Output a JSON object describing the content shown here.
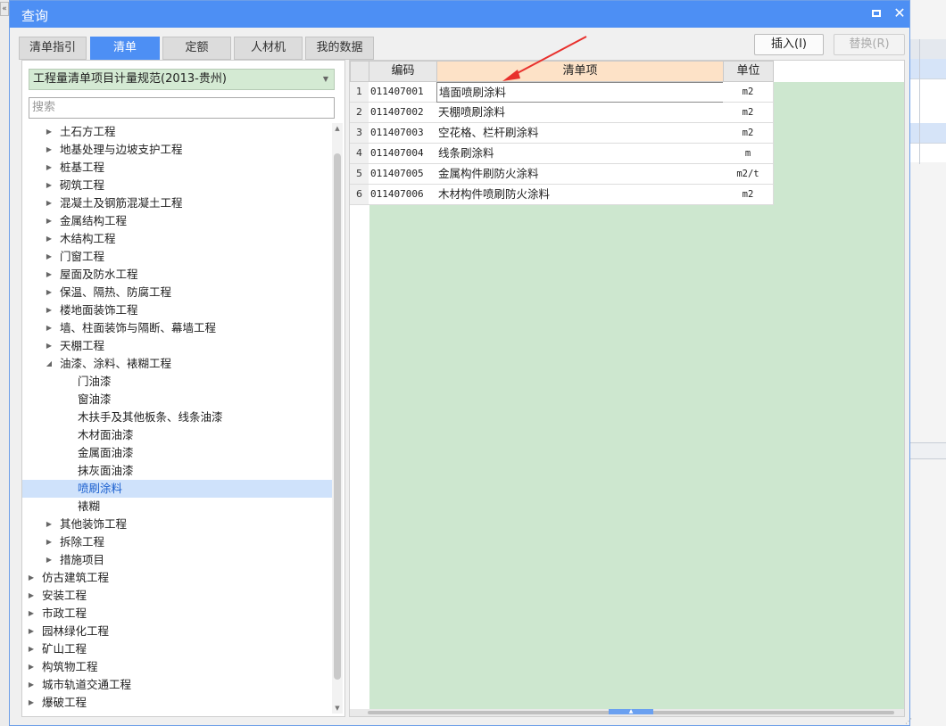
{
  "window": {
    "title": "查询"
  },
  "tabs": [
    {
      "label": "清单指引",
      "active": false
    },
    {
      "label": "清单",
      "active": true
    },
    {
      "label": "定额",
      "active": false
    },
    {
      "label": "人材机",
      "active": false
    },
    {
      "label": "我的数据",
      "active": false
    }
  ],
  "actions": {
    "insert": "插入(I)",
    "replace": "替换(R)"
  },
  "spec": {
    "selected": "工程量清单项目计量规范(2013-贵州)"
  },
  "search": {
    "placeholder": "搜索"
  },
  "tree": [
    {
      "label": "土石方工程",
      "level": 1,
      "expandable": true,
      "expanded": false
    },
    {
      "label": "地基处理与边坡支护工程",
      "level": 1,
      "expandable": true,
      "expanded": false
    },
    {
      "label": "桩基工程",
      "level": 1,
      "expandable": true,
      "expanded": false
    },
    {
      "label": "砌筑工程",
      "level": 1,
      "expandable": true,
      "expanded": false
    },
    {
      "label": "混凝土及钢筋混凝土工程",
      "level": 1,
      "expandable": true,
      "expanded": false
    },
    {
      "label": "金属结构工程",
      "level": 1,
      "expandable": true,
      "expanded": false
    },
    {
      "label": "木结构工程",
      "level": 1,
      "expandable": true,
      "expanded": false
    },
    {
      "label": "门窗工程",
      "level": 1,
      "expandable": true,
      "expanded": false
    },
    {
      "label": "屋面及防水工程",
      "level": 1,
      "expandable": true,
      "expanded": false
    },
    {
      "label": "保温、隔热、防腐工程",
      "level": 1,
      "expandable": true,
      "expanded": false
    },
    {
      "label": "楼地面装饰工程",
      "level": 1,
      "expandable": true,
      "expanded": false
    },
    {
      "label": "墙、柱面装饰与隔断、幕墙工程",
      "level": 1,
      "expandable": true,
      "expanded": false
    },
    {
      "label": "天棚工程",
      "level": 1,
      "expandable": true,
      "expanded": false
    },
    {
      "label": "油漆、涂料、裱糊工程",
      "level": 1,
      "expandable": true,
      "expanded": true
    },
    {
      "label": "门油漆",
      "level": 2,
      "expandable": false
    },
    {
      "label": "窗油漆",
      "level": 2,
      "expandable": false
    },
    {
      "label": "木扶手及其他板条、线条油漆",
      "level": 2,
      "expandable": false
    },
    {
      "label": "木材面油漆",
      "level": 2,
      "expandable": false
    },
    {
      "label": "金属面油漆",
      "level": 2,
      "expandable": false
    },
    {
      "label": "抹灰面油漆",
      "level": 2,
      "expandable": false
    },
    {
      "label": "喷刷涂料",
      "level": 2,
      "expandable": false,
      "selected": true
    },
    {
      "label": "裱糊",
      "level": 2,
      "expandable": false
    },
    {
      "label": "其他装饰工程",
      "level": 1,
      "expandable": true,
      "expanded": false
    },
    {
      "label": "拆除工程",
      "level": 1,
      "expandable": true,
      "expanded": false
    },
    {
      "label": "措施项目",
      "level": 1,
      "expandable": true,
      "expanded": false
    },
    {
      "label": "仿古建筑工程",
      "level": 0,
      "expandable": true,
      "expanded": false
    },
    {
      "label": "安装工程",
      "level": 0,
      "expandable": true,
      "expanded": false
    },
    {
      "label": "市政工程",
      "level": 0,
      "expandable": true,
      "expanded": false
    },
    {
      "label": "园林绿化工程",
      "level": 0,
      "expandable": true,
      "expanded": false
    },
    {
      "label": "矿山工程",
      "level": 0,
      "expandable": true,
      "expanded": false
    },
    {
      "label": "构筑物工程",
      "level": 0,
      "expandable": true,
      "expanded": false
    },
    {
      "label": "城市轨道交通工程",
      "level": 0,
      "expandable": true,
      "expanded": false
    },
    {
      "label": "爆破工程",
      "level": 0,
      "expandable": true,
      "expanded": false
    }
  ],
  "grid": {
    "headers": {
      "code": "编码",
      "name": "清单项",
      "unit": "单位"
    },
    "rows": [
      {
        "num": "1",
        "code": "011407001",
        "name": "墙面喷刷涂料",
        "unit": "m2"
      },
      {
        "num": "2",
        "code": "011407002",
        "name": "天棚喷刷涂料",
        "unit": "m2"
      },
      {
        "num": "3",
        "code": "011407003",
        "name": "空花格、栏杆刷涂料",
        "unit": "m2"
      },
      {
        "num": "4",
        "code": "011407004",
        "name": "线条刷涂料",
        "unit": "m"
      },
      {
        "num": "5",
        "code": "011407005",
        "name": "金属构件刷防火涂料",
        "unit": "m2/t"
      },
      {
        "num": "6",
        "code": "011407006",
        "name": "木材构件喷刷防火涂料",
        "unit": "m2"
      }
    ]
  },
  "colors": {
    "accent": "#4d8ff4",
    "spec_bg": "#d4ead3",
    "grid_bg": "#cde7cf",
    "header_highlight": "#fde2c7",
    "selected_row": "#cfe2fb",
    "annotation_arrow": "#e8302c"
  },
  "icons": {
    "maximize": "maximize-icon",
    "close": "close-icon",
    "expand": "triangle-right-icon",
    "collapse": "triangle-down-icon",
    "dropdown": "chevron-down-icon"
  }
}
